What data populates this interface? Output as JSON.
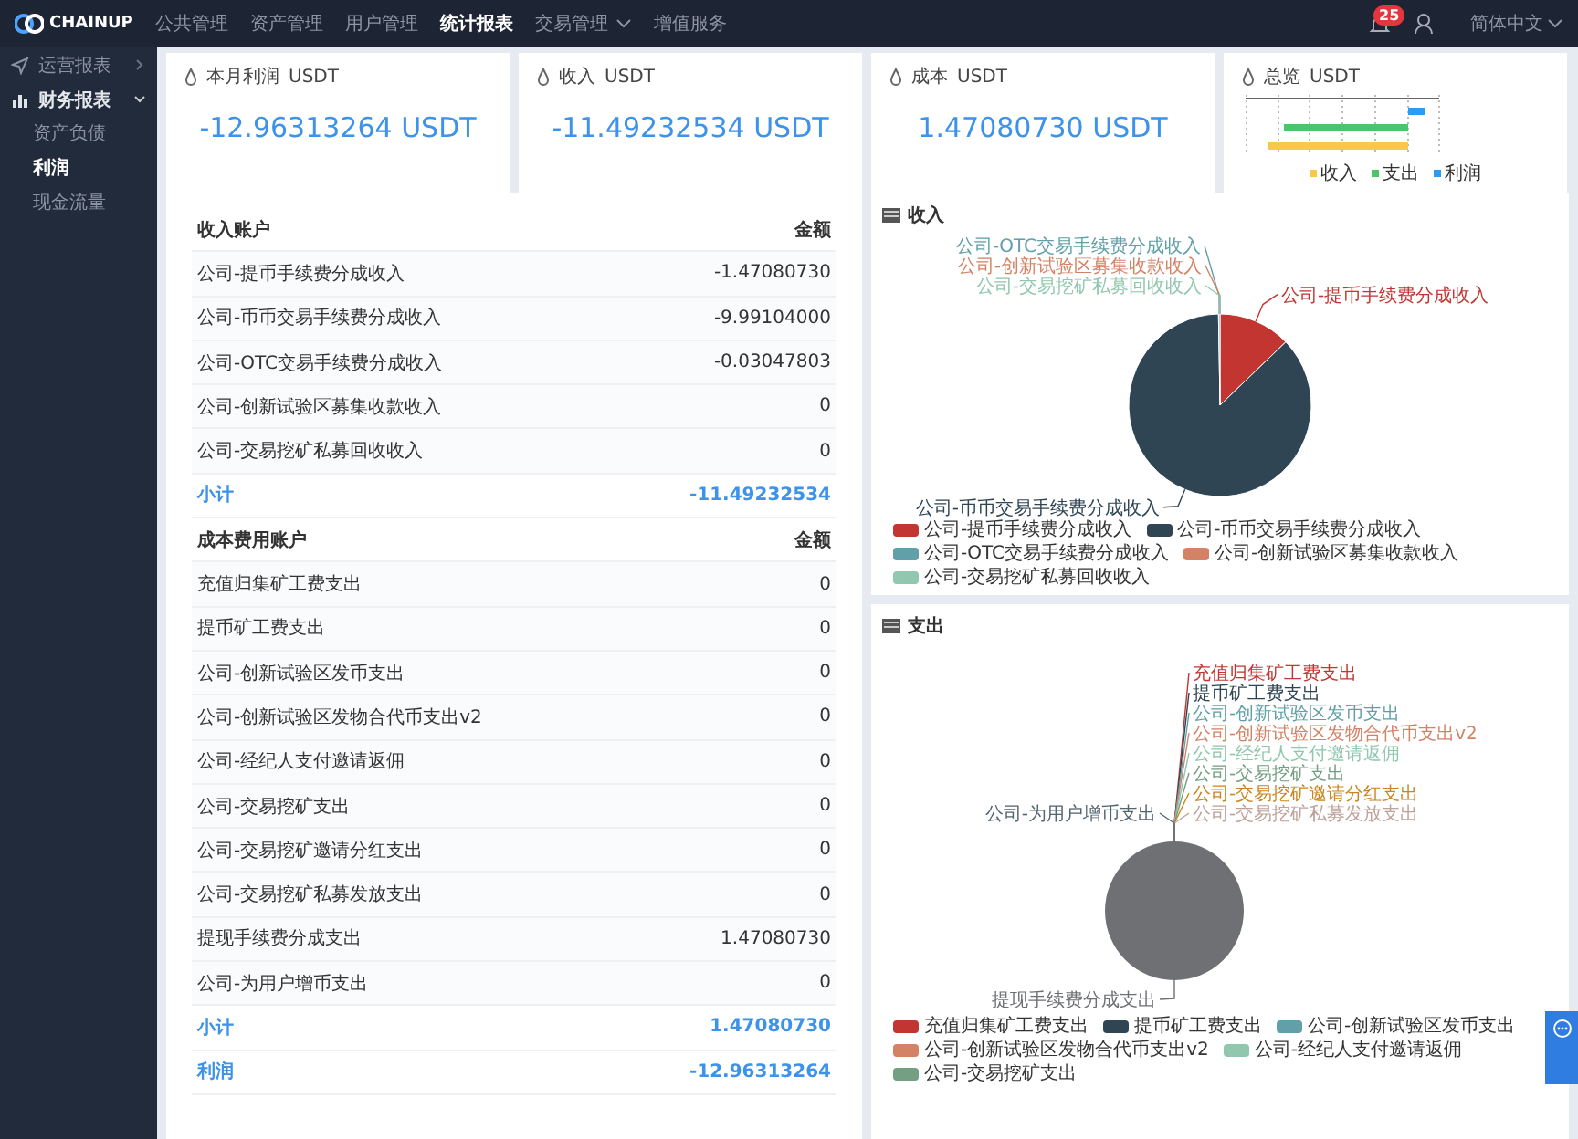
{
  "topbar": {
    "logo": "CHAINUP",
    "menu": [
      {
        "label": "公共管理",
        "selected": false,
        "dropdown": false
      },
      {
        "label": "资产管理",
        "selected": false,
        "dropdown": false
      },
      {
        "label": "用户管理",
        "selected": false,
        "dropdown": false
      },
      {
        "label": "统计报表",
        "selected": true,
        "dropdown": false
      },
      {
        "label": "交易管理",
        "selected": false,
        "dropdown": true
      },
      {
        "label": "增值服务",
        "selected": false,
        "dropdown": false
      }
    ],
    "notification_count": "25",
    "language": "简体中文"
  },
  "sidebar": {
    "items": [
      {
        "label": "运营报表",
        "expanded": false
      },
      {
        "label": "财务报表",
        "expanded": true,
        "children": [
          {
            "label": "资产负债",
            "selected": false
          },
          {
            "label": "利润",
            "selected": true
          },
          {
            "label": "现金流量",
            "selected": false
          }
        ]
      }
    ]
  },
  "stat_cards": [
    {
      "kind": "value",
      "title": "本月利润",
      "unit": "USDT",
      "value": "-12.96313264 USDT"
    },
    {
      "kind": "value",
      "title": "收入",
      "unit": "USDT",
      "value": "-11.49232534 USDT"
    },
    {
      "kind": "value",
      "title": "成本",
      "unit": "USDT",
      "value": "1.47080730 USDT"
    },
    {
      "kind": "chart",
      "title": "总览",
      "unit": "USDT",
      "legend": [
        {
          "label": "收入",
          "color": "#f7c948"
        },
        {
          "label": "支出",
          "color": "#4cc46a"
        },
        {
          "label": "利润",
          "color": "#2d9cf0"
        }
      ]
    }
  ],
  "table": {
    "rows": [
      {
        "kind": "header",
        "account": "收入账户",
        "amount": "金额"
      },
      {
        "kind": "item",
        "account": "公司-提币手续费分成收入",
        "amount": "-1.47080730"
      },
      {
        "kind": "item",
        "account": "公司-币币交易手续费分成收入",
        "amount": "-9.99104000"
      },
      {
        "kind": "item",
        "account": "公司-OTC交易手续费分成收入",
        "amount": "-0.03047803"
      },
      {
        "kind": "item",
        "account": "公司-创新试验区募集收款收入",
        "amount": "0"
      },
      {
        "kind": "item",
        "account": "公司-交易挖矿私募回收收入",
        "amount": "0"
      },
      {
        "kind": "subtotal",
        "account": "小计",
        "amount": "-11.49232534"
      },
      {
        "kind": "header",
        "account": "成本费用账户",
        "amount": "金额"
      },
      {
        "kind": "item",
        "account": "充值归集矿工费支出",
        "amount": "0"
      },
      {
        "kind": "item",
        "account": "提币矿工费支出",
        "amount": "0"
      },
      {
        "kind": "item",
        "account": "公司-创新试验区发币支出",
        "amount": "0"
      },
      {
        "kind": "item",
        "account": "公司-创新试验区发物合代币支出v2",
        "amount": "0"
      },
      {
        "kind": "item",
        "account": "公司-经纪人支付邀请返佣",
        "amount": "0"
      },
      {
        "kind": "item",
        "account": "公司-交易挖矿支出",
        "amount": "0"
      },
      {
        "kind": "item",
        "account": "公司-交易挖矿邀请分红支出",
        "amount": "0"
      },
      {
        "kind": "item",
        "account": "公司-交易挖矿私募发放支出",
        "amount": "0"
      },
      {
        "kind": "item",
        "account": "提现手续费分成支出",
        "amount": "1.47080730"
      },
      {
        "kind": "item",
        "account": "公司-为用户增币支出",
        "amount": "0"
      },
      {
        "kind": "subtotal",
        "account": "小计",
        "amount": "1.47080730"
      },
      {
        "kind": "total",
        "account": "利润",
        "amount": "-12.96313264"
      }
    ]
  },
  "charts": [
    {
      "chart_data": {
        "type": "pie",
        "title": "收入",
        "categories": [
          "公司-提币手续费分成收入",
          "公司-币币交易手续费分成收入",
          "公司-OTC交易手续费分成收入",
          "公司-创新试验区募集收款收入",
          "公司-交易挖矿私募回收收入"
        ],
        "values": [
          12.8,
          86.93,
          0.27,
          0,
          0
        ],
        "colors": [
          "#c23531",
          "#2f4554",
          "#61a0a8",
          "#d48265",
          "#91c7ae"
        ]
      },
      "legend": [
        {
          "label": "公司-提币手续费分成收入",
          "color": "#c23531"
        },
        {
          "label": "公司-币币交易手续费分成收入",
          "color": "#2f4554"
        },
        {
          "label": "公司-OTC交易手续费分成收入",
          "color": "#61a0a8"
        },
        {
          "label": "公司-创新试验区募集收款收入",
          "color": "#d48265"
        },
        {
          "label": "公司-交易挖矿私募回收收入",
          "color": "#91c7ae"
        }
      ]
    },
    {
      "chart_data": {
        "type": "pie",
        "title": "支出",
        "categories": [
          "充值归集矿工费支出",
          "提币矿工费支出",
          "公司-创新试验区发币支出",
          "公司-创新试验区发物合代币支出v2",
          "公司-经纪人支付邀请返佣",
          "公司-交易挖矿支出",
          "公司-交易挖矿邀请分红支出",
          "公司-交易挖矿私募发放支出",
          "提现手续费分成支出",
          "公司-为用户增币支出"
        ],
        "values": [
          0,
          0,
          0,
          0,
          0,
          0,
          0,
          0,
          100,
          0
        ],
        "colors": [
          "#c23531",
          "#2f4554",
          "#61a0a8",
          "#d48265",
          "#91c7ae",
          "#749f83",
          "#ca8622",
          "#bda29a",
          "#6e7074",
          "#546570"
        ]
      },
      "legend": [
        {
          "label": "充值归集矿工费支出",
          "color": "#c23531"
        },
        {
          "label": "提币矿工费支出",
          "color": "#2f4554"
        },
        {
          "label": "公司-创新试验区发币支出",
          "color": "#61a0a8"
        },
        {
          "label": "公司-创新试验区发物合代币支出v2",
          "color": "#d48265"
        },
        {
          "label": "公司-经纪人支付邀请返佣",
          "color": "#91c7ae"
        },
        {
          "label": "公司-交易挖矿支出",
          "color": "#749f83"
        }
      ]
    }
  ]
}
